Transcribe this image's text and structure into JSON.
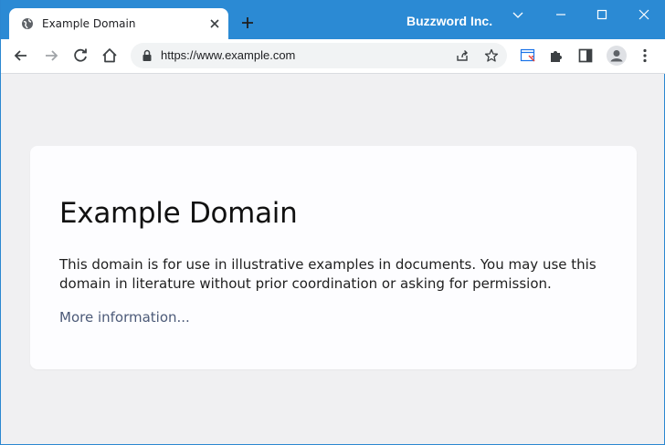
{
  "window": {
    "title": "Buzzword Inc."
  },
  "tab": {
    "title": "Example Domain"
  },
  "address_bar": {
    "url": "https://www.example.com"
  },
  "page": {
    "heading": "Example Domain",
    "paragraph": "This domain is for use in illustrative examples in documents. You may use this domain in literature without prior coordination or asking for permission.",
    "link": "More information..."
  },
  "colors": {
    "titlebar": "#2b8ad4",
    "page_background": "#f0f0f2",
    "link": "#4c5a78"
  }
}
